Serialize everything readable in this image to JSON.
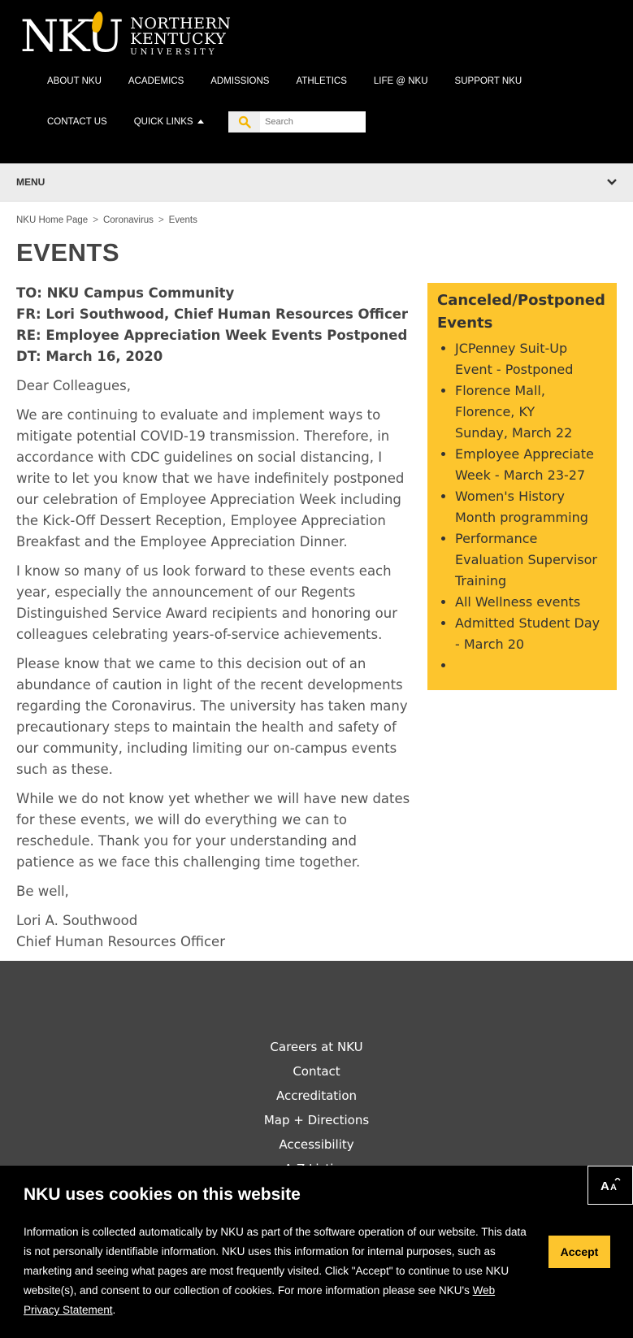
{
  "header": {
    "logo": {
      "mark": "NKU",
      "line1": "NORTHERN",
      "line2": "KENTUCKY",
      "line3": "UNIVERSITY"
    },
    "nav_primary": [
      "ABOUT NKU",
      "ACADEMICS",
      "ADMISSIONS",
      "ATHLETICS",
      "LIFE @ NKU",
      "SUPPORT NKU"
    ],
    "nav_secondary": {
      "contact": "CONTACT US",
      "quick_links": "QUICK LINKS"
    },
    "search": {
      "placeholder": "Search"
    }
  },
  "menubar": {
    "label": "MENU"
  },
  "breadcrumb": [
    "NKU Home Page",
    "Coronavirus",
    "Events"
  ],
  "page_title": "EVENTS",
  "memo": {
    "to": "TO: NKU Campus Community",
    "fr": "FR: Lori Southwood, Chief Human Resources Officer",
    "re": "RE: Employee Appreciation Week Events Postponed",
    "dt": "DT: March 16, 2020"
  },
  "body": {
    "greeting": "Dear Colleagues,",
    "p1": "We are continuing to evaluate and implement ways to mitigate potential COVID-19 transmission. Therefore, in accordance with CDC guidelines on social distancing, I write to let you know that we have indefinitely postponed our celebration of Employee Appreciation Week including the Kick-Off Dessert Reception, Employee Appreciation Breakfast and the Employee Appreciation Dinner.",
    "p2": "I know so many of us look forward to these events each year, especially the announcement of our Regents Distinguished Service Award recipients and honoring our colleagues celebrating years-of-service achievements.",
    "p3": "Please know that we came to this decision out of an abundance of caution in light of the recent developments regarding the Coronavirus. The university has taken many precautionary steps to maintain the health and safety of our community, including limiting our on-campus events such as these.",
    "p4": "While we do not know yet whether we will have new dates for these events, we will do everything we can to reschedule. Thank you for your understanding and patience as we face this challenging time together.",
    "closing": "Be well,",
    "sig_name": "Lori A. Southwood",
    "sig_title": "Chief Human Resources Officer"
  },
  "sidebar": {
    "title": "Canceled/Postponed Events",
    "items": [
      "JCPenney Suit-Up Event - Postponed",
      "Florence Mall, Florence, KY",
      "Sunday, March 22",
      "Employee Appreciate Week - March 23-27",
      "Women's History Month programming",
      "Performance Evaluation Supervisor Training",
      "All Wellness events",
      "Admitted Student Day - March 20"
    ]
  },
  "footer": {
    "links": [
      "Careers at NKU",
      "Contact",
      "Accreditation",
      "Map + Directions",
      "Accessibility",
      "A-Z Listing"
    ]
  },
  "cookie": {
    "title": "NKU uses cookies on this website",
    "text": "Information is collected automatically by NKU as part of the software operation of our website. This data is not personally identifiable information. NKU uses this information for internal purposes, such as marketing and seeing what pages are most frequently visited. Click \"Accept\" to continue to use NKU website(s), and consent to our collection of cookies. For more information please see NKU's",
    "link": "Web Privacy Statement",
    "accept": "Accept"
  },
  "a11y_button": {
    "label": "A"
  },
  "colors": {
    "accent": "#fdc52d",
    "header_bg": "#000000",
    "footer_bg": "#444444"
  }
}
